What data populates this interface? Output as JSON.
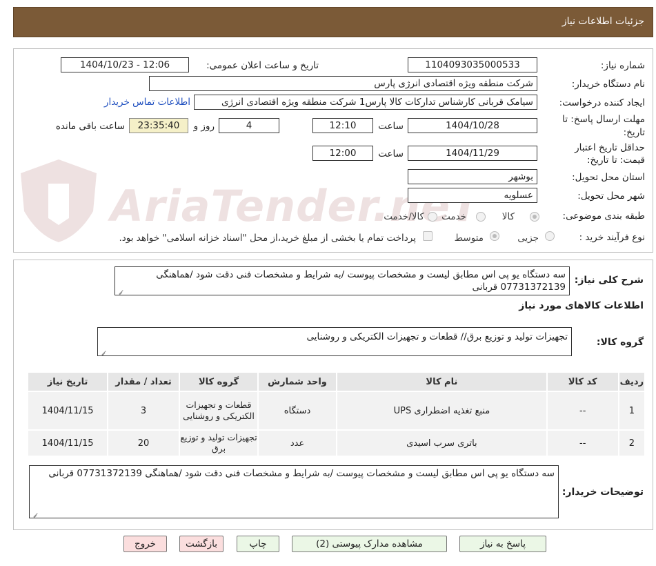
{
  "header": {
    "title": "جزئیات اطلاعات نیاز"
  },
  "form": {
    "need_number": {
      "label": "شماره نیاز:",
      "value": "1104093035000533"
    },
    "announce": {
      "label": "تاریخ و ساعت اعلان عمومی:",
      "value": "1404/10/23 - 12:06"
    },
    "buyer_org": {
      "label": "نام دستگاه خریدار:",
      "value": "شرکت منطقه ویژه اقتصادی انرژی پارس"
    },
    "creator": {
      "label": "ایجاد کننده درخواست:",
      "value": "سیامک قربانی کارشناس تدارکات کالا پارس1 شرکت منطقه ویژه اقتصادی انرژی",
      "contact_link": "اطلاعات تماس خریدار"
    },
    "deadline": {
      "label_line1": "مهلت ارسال پاسخ: تا",
      "label_line2": "تاریخ:",
      "date": "1404/10/28",
      "time_label": "ساعت",
      "time": "12:10",
      "days": "4",
      "days_label": "روز و",
      "remaining": "23:35:40",
      "remaining_label": "ساعت باقی مانده"
    },
    "validity": {
      "label_line1": "حداقل تاریخ اعتبار",
      "label_line2": "قیمت: تا تاریخ:",
      "date": "1404/11/29",
      "time_label": "ساعت",
      "time": "12:00"
    },
    "province": {
      "label": "استان محل تحویل:",
      "value": "بوشهر"
    },
    "city": {
      "label": "شهر محل تحویل:",
      "value": "عسلویه"
    },
    "category": {
      "label": "طبقه بندی موضوعی:",
      "options": [
        "کالا",
        "خدمت",
        "کالا/خدمت"
      ],
      "selected": "کالا"
    },
    "process": {
      "label": "نوع فرآیند خرید :",
      "options": [
        "جزیی",
        "متوسط"
      ],
      "selected": "متوسط",
      "payment_note": "پرداخت تمام یا بخشی از مبلغ خرید،از محل \"اسناد خزانه اسلامی\" خواهد بود."
    }
  },
  "summary": {
    "label": "شرح کلی نیاز:",
    "text": "سه دستگاه یو پی اس مطابق لیست و مشخصات پیوست /به شرایط و مشخصات فنی دقت شود /هماهنگی 07731372139 قربانی"
  },
  "goods": {
    "section_title": "اطلاعات کالاهای مورد نیاز",
    "group_label": "گروه کالا:",
    "group_value": "تجهیزات تولید و توزیع برق// قطعات و تجهیزات الکتریکی و روشنایی",
    "columns": [
      "ردیف",
      "کد کالا",
      "نام کالا",
      "واحد شمارش",
      "گروه کالا",
      "تعداد / مقدار",
      "تاریخ نیاز"
    ],
    "rows": [
      [
        "1",
        "--",
        "منبع تغذیه اضطراری UPS",
        "دستگاه",
        "قطعات و تجهیزات الکتریکی و روشنایی",
        "3",
        "1404/11/15"
      ],
      [
        "2",
        "--",
        "باتری سرب اسیدی",
        "عدد",
        "تجهیزات تولید و توزیع برق",
        "20",
        "1404/11/15"
      ]
    ]
  },
  "buyer_notes": {
    "label": "توضیحات خریدار:",
    "text": "سه دستگاه یو پی اس مطابق لیست و مشخصات پیوست /به شرایط و مشخصات فنی دقت شود /هماهنگی 07731372139 قربانی"
  },
  "buttons": {
    "reply": "پاسخ به نیاز",
    "attachments": "مشاهده مدارک پیوستی (2)",
    "print": "چاپ",
    "back": "بازگشت",
    "exit": "خروج"
  },
  "watermark": {
    "text": "AriaTender.neT"
  },
  "colors": {
    "header_bg": "#7b5a37",
    "link": "#1f4fbf",
    "button_green": "#ebf7e6",
    "button_red": "#fbdede",
    "remaining_bg": "#f5f0c8"
  }
}
